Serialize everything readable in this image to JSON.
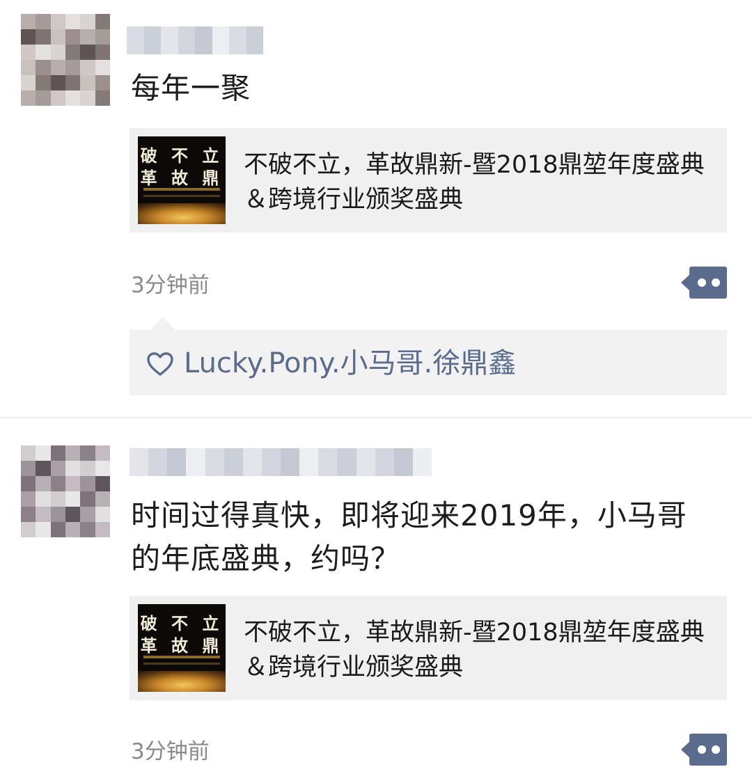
{
  "posts": [
    {
      "text": "每年一聚",
      "link_title": "不破不立，革故鼎新-暨2018鼎堃年度盛典＆跨境行业颁奖盛典",
      "link_thumb_line1": "破 不 立",
      "link_thumb_line2": "革 故 鼎",
      "time": "3分钟前",
      "likes": [
        "Lucky.Pony.小马哥.徐鼎鑫"
      ]
    },
    {
      "text": "时间过得真快，即将迎来2019年，小马哥的年底盛典，约吗？",
      "link_title": "不破不立，革故鼎新-暨2018鼎堃年度盛典＆跨境行业颁奖盛典",
      "link_thumb_line1": "破 不 立",
      "link_thumb_line2": "革 故 鼎",
      "time": "3分钟前"
    }
  ],
  "icons": {
    "more": "more-dots-icon",
    "like": "heart-icon"
  },
  "colors": {
    "link_blue": "#5b6b8d",
    "time_gray": "#8a8a8a",
    "card_bg": "#f0f0f0"
  }
}
